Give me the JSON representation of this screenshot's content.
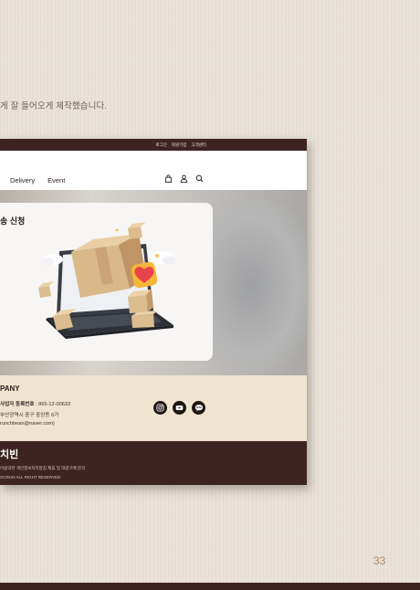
{
  "caption": "게 잘 들어오게 제작했습니다.",
  "topbar": {
    "links": [
      "로그인",
      "회원가입",
      "고객센터"
    ]
  },
  "nav": {
    "menu": [
      "Delivery",
      "Event"
    ],
    "icons": [
      "bag-icon",
      "user-icon",
      "search-icon"
    ]
  },
  "hero": {
    "title": "송 신청"
  },
  "footer": {
    "company": "PANY",
    "business_label": "사업자 등록번호",
    "business_number": " : 865-12-00633",
    "address": "부산광역시 중구 중앙동 6가",
    "email": "runchbean@naver.com)",
    "social": [
      "instagram-icon",
      "youtube-icon",
      "talk-icon"
    ],
    "talk_label": "TALK"
  },
  "footer_bottom": {
    "brand": "치빈",
    "line1": "이용약관  개인정보처리방침  제휴 및 대량구매 문의",
    "line2": "OCRUN ALL RIGHT RESERVED"
  },
  "page_number": "33",
  "colors": {
    "dark_brown": "#3e2421",
    "beige": "#f0e4d0",
    "background": "#e8e1d7",
    "accent": "#b98a66"
  }
}
